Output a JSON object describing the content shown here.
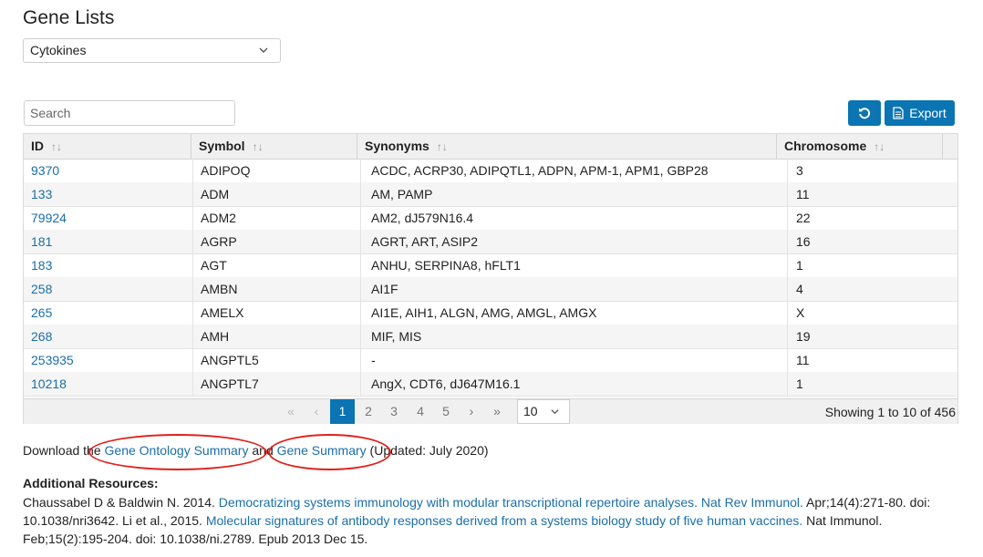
{
  "page_title": "Gene Lists",
  "list_select": {
    "value": "Cytokines",
    "icon": "chevron-down-icon"
  },
  "search": {
    "placeholder": "Search"
  },
  "toolbar": {
    "reset_icon": "refresh-icon",
    "export_label": "Export",
    "export_icon": "document-icon"
  },
  "table": {
    "headers": [
      "ID",
      "Symbol",
      "Synonyms",
      "Chromosome"
    ],
    "rows": [
      {
        "id": "9370",
        "symbol": "ADIPOQ",
        "synonyms": "ACDC, ACRP30, ADIPQTL1, ADPN, APM-1, APM1, GBP28",
        "chromosome": "3"
      },
      {
        "id": "133",
        "symbol": "ADM",
        "synonyms": "AM, PAMP",
        "chromosome": "11"
      },
      {
        "id": "79924",
        "symbol": "ADM2",
        "synonyms": "AM2, dJ579N16.4",
        "chromosome": "22"
      },
      {
        "id": "181",
        "symbol": "AGRP",
        "synonyms": "AGRT, ART, ASIP2",
        "chromosome": "16"
      },
      {
        "id": "183",
        "symbol": "AGT",
        "synonyms": "ANHU, SERPINA8, hFLT1",
        "chromosome": "1"
      },
      {
        "id": "258",
        "symbol": "AMBN",
        "synonyms": "AI1F",
        "chromosome": "4"
      },
      {
        "id": "265",
        "symbol": "AMELX",
        "synonyms": "AI1E, AIH1, ALGN, AMG, AMGL, AMGX",
        "chromosome": "X"
      },
      {
        "id": "268",
        "symbol": "AMH",
        "synonyms": "MIF, MIS",
        "chromosome": "19"
      },
      {
        "id": "253935",
        "symbol": "ANGPTL5",
        "synonyms": "-",
        "chromosome": "11"
      },
      {
        "id": "10218",
        "symbol": "ANGPTL7",
        "synonyms": "AngX, CDT6, dJ647M16.1",
        "chromosome": "1"
      }
    ]
  },
  "pagination": {
    "first": "«",
    "prev": "‹",
    "pages": [
      "1",
      "2",
      "3",
      "4",
      "5"
    ],
    "active_page": "1",
    "next": "›",
    "last": "»",
    "page_size": "10",
    "showing": "Showing 1 to 10 of 456"
  },
  "download": {
    "prefix": "Download the ",
    "link1": "Gene Ontology Summary",
    "middle": " and ",
    "link2": "Gene Summary",
    "suffix": " (Updated: July 2020)"
  },
  "resources": {
    "title": "Additional Resources:",
    "ref1_text": "Chaussabel D & Baldwin N. 2014. ",
    "ref1_link": "Democratizing systems immunology with modular transcriptional repertoire analyses. Nat Rev Immunol.",
    "ref1_tail": " Apr;14(4):271-80. doi: 10.1038/nri3642. Li et al., 2015. ",
    "ref2_link": "Molecular signatures of antibody responses derived from a systems biology study of five human vaccines.",
    "ref2_tail": " Nat Immunol. Feb;15(2):195-204. doi: 10.1038/ni.2789. Epub 2013 Dec 15."
  },
  "colors": {
    "accent": "#0b74b3",
    "link": "#1a6ea8",
    "annotation": "#e0201c"
  }
}
